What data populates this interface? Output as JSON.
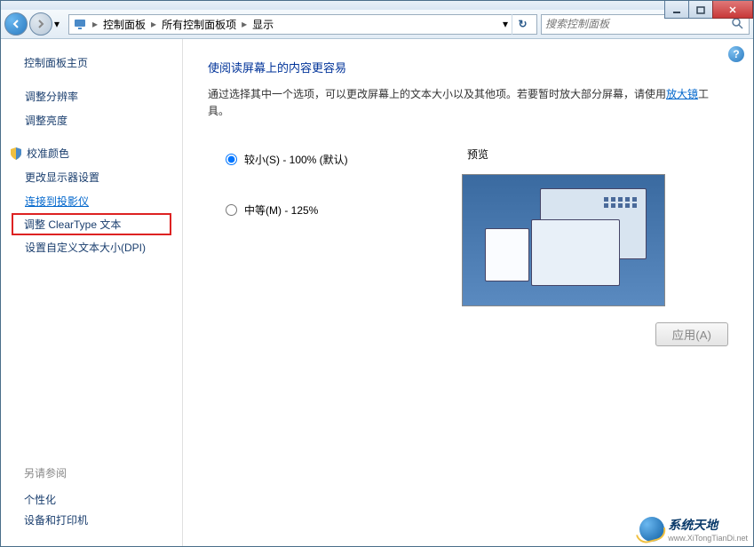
{
  "breadcrumb": {
    "item1": "控制面板",
    "item2": "所有控制面板项",
    "item3": "显示"
  },
  "search": {
    "placeholder": "搜索控制面板"
  },
  "sidebar": {
    "title": "控制面板主页",
    "items": [
      {
        "label": "调整分辨率"
      },
      {
        "label": "调整亮度"
      },
      {
        "label": "校准颜色"
      },
      {
        "label": "更改显示器设置"
      },
      {
        "label": "连接到投影仪"
      },
      {
        "label": "调整 ClearType 文本"
      },
      {
        "label": "设置自定义文本大小(DPI)"
      }
    ],
    "see_also_title": "另请参阅",
    "see_also": [
      {
        "label": "个性化"
      },
      {
        "label": "设备和打印机"
      }
    ]
  },
  "main": {
    "title": "使阅读屏幕上的内容更容易",
    "desc_prefix": "通过选择其中一个选项，可以更改屏幕上的文本大小以及其他项。若要暂时放大部分屏幕，请使用",
    "desc_link": "放大镜",
    "desc_suffix": "工具。",
    "options": [
      {
        "label": "较小(S) - 100% (默认)",
        "checked": true
      },
      {
        "label": "中等(M) - 125%",
        "checked": false
      }
    ],
    "preview_label": "预览",
    "apply_label": "应用(A)"
  },
  "watermark": {
    "text": "系统天地",
    "url": "www.XiTongTianDi.net"
  }
}
